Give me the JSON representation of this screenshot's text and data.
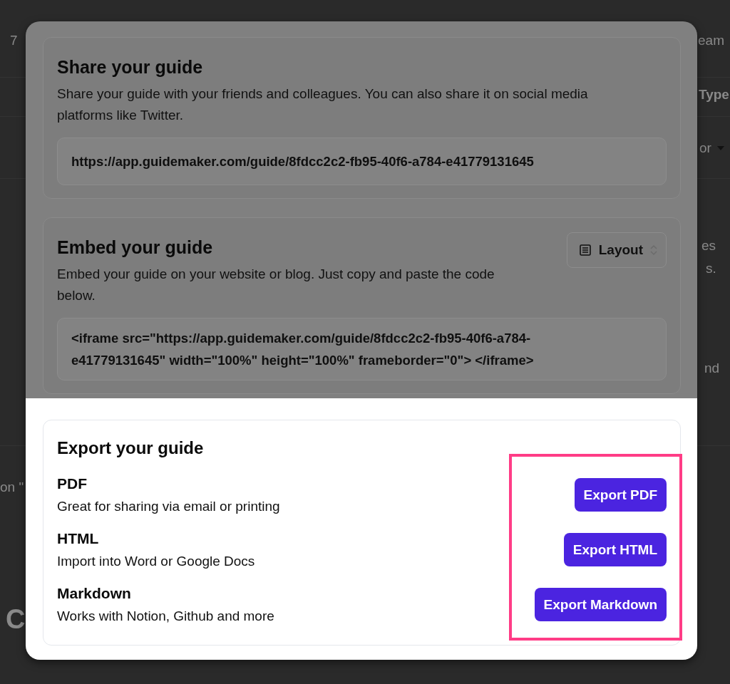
{
  "background_fragments": [
    {
      "text": "7",
      "kind": "plain"
    },
    {
      "text": "eam",
      "kind": "plain"
    },
    {
      "text": "Type",
      "kind": "bold"
    },
    {
      "text": "or",
      "kind": "dropdown"
    },
    {
      "text": "es",
      "kind": "plain"
    },
    {
      "text": "s.",
      "kind": "plain"
    },
    {
      "text": "nd",
      "kind": "plain"
    },
    {
      "text": "on \"",
      "kind": "plain"
    },
    {
      "text": "C",
      "kind": "heading"
    }
  ],
  "dialog": {
    "sections": [
      {
        "kind": "share",
        "highlighted": false,
        "title": "Share your guide",
        "description": "Share your guide with your friends and colleagues. You can also share it on social media platforms like Twitter.",
        "link_field": {
          "value": "https://app.guidemaker.com/guide/8fdcc2c2-fb95-40f6-a784-e41779131645"
        }
      },
      {
        "kind": "embed",
        "highlighted": false,
        "title": "Embed your guide",
        "description": "Embed your guide on your website or blog. Just copy and paste the code below.",
        "layout_select": {
          "value": "Layout"
        },
        "code_field": {
          "value": "<iframe src=\"https://app.guidemaker.com/guide/8fdcc2c2-fb95-40f6-a784-e41779131645\" width=\"100%\" height=\"100%\" frameborder=\"0\"> </iframe>"
        }
      },
      {
        "kind": "export",
        "highlighted": true,
        "title": "Export your guide",
        "buttons_outlined": true,
        "formats": [
          {
            "name": "PDF",
            "description": "Great for sharing via email or printing",
            "button": "Export PDF"
          },
          {
            "name": "HTML",
            "description": "Import into Word or Google Docs",
            "button": "Export HTML"
          },
          {
            "name": "Markdown",
            "description": "Works with Notion, Github and more",
            "button": "Export Markdown"
          }
        ]
      }
    ]
  }
}
